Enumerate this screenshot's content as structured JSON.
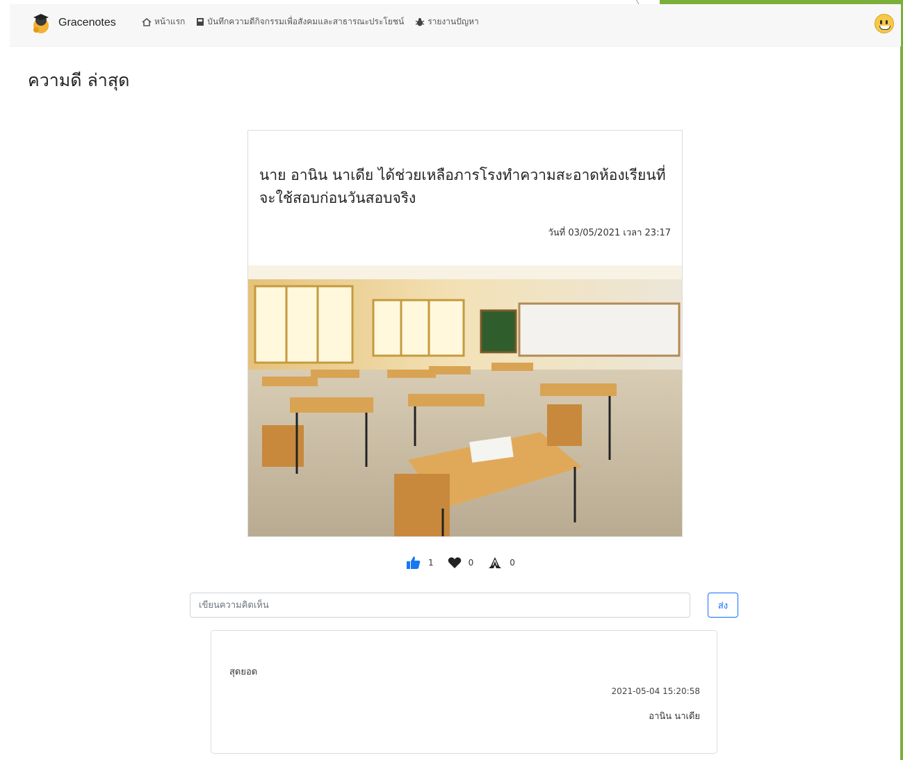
{
  "navbar": {
    "brand": "Gracenotes",
    "links": [
      {
        "icon": "home-icon",
        "label": "หน้าแรก"
      },
      {
        "icon": "book-icon",
        "label": "บันทึกความดีกิจกรรมเพื่อสังคมและสาธารณะประโยชน์"
      },
      {
        "icon": "bug-icon",
        "label": "รายงานปัญหา"
      }
    ]
  },
  "page": {
    "title": "ความดี ล่าสุด"
  },
  "post": {
    "title": "นาย อานิน นาเดีย ได้ช่วยเหลือภารโรงทำความสะอาดห้องเรียนที่จะใช้สอบก่อนวันสอบจริง",
    "date": "วันที่ 03/05/2021 เวลา 23:17",
    "image_desc": "classroom-photo"
  },
  "reactions": [
    {
      "icon": "thumbs-up-icon",
      "count": "1",
      "color": "#1877f2"
    },
    {
      "icon": "heart-icon",
      "count": "0",
      "color": "#222222"
    },
    {
      "icon": "praying-hands-icon",
      "count": "0",
      "color": "#222222"
    }
  ],
  "comment_form": {
    "placeholder": "เขียนความคิดเห็น",
    "submit_label": "ส่ง"
  },
  "comments": [
    {
      "text": "สุดยอด",
      "timestamp": "2021-05-04 15:20:58",
      "author": "อานิน นาเดีย"
    }
  ],
  "colors": {
    "accent": "#0d6efd",
    "frame": "#7cae3a"
  }
}
